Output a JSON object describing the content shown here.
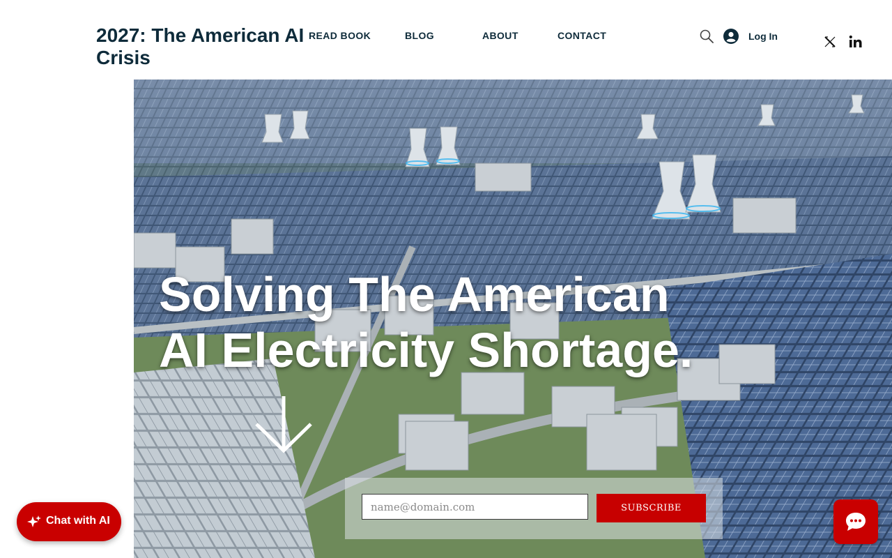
{
  "header": {
    "site_title": "2027: The American AI Crisis",
    "nav": [
      "READ BOOK",
      "BLOG",
      "ABOUT",
      "CONTACT"
    ],
    "login_label": "Log In",
    "icons": [
      "search-icon",
      "user-avatar-icon",
      "x-twitter-icon",
      "linkedin-icon"
    ]
  },
  "hero": {
    "headline_line1": "Solving The American",
    "headline_line2": "AI Electricity Shortage.",
    "arrow_icon": "arrow-down-icon"
  },
  "subscribe": {
    "email_placeholder": "name@domain.com",
    "button_label": "SUBSCRIBE"
  },
  "chat": {
    "ai_button_label": "Chat with AI",
    "widget_icon": "chat-bubble-icon"
  },
  "colors": {
    "title_navy": "#0e2b3a",
    "accent_red": "#c70000",
    "text_white": "#ffffff"
  }
}
